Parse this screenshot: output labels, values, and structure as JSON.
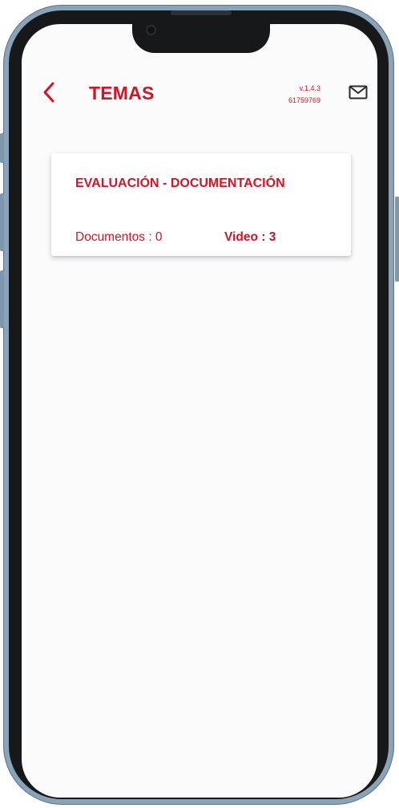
{
  "header": {
    "title": "TEMAS",
    "version": "v.1.4.3",
    "build": "61759769",
    "back_icon": "chevron-left-icon",
    "mail_icon": "mail-icon"
  },
  "topic_card": {
    "title": "EVALUACIÓN - DOCUMENTACIÓN",
    "documents": "Documentos : 0",
    "video": "Video : 3"
  },
  "colors": {
    "accent": "#d41425",
    "background": "#fbfbfc",
    "card": "#ffffff",
    "device_frame": "#8aa3b8",
    "device_bezel": "#161819"
  }
}
